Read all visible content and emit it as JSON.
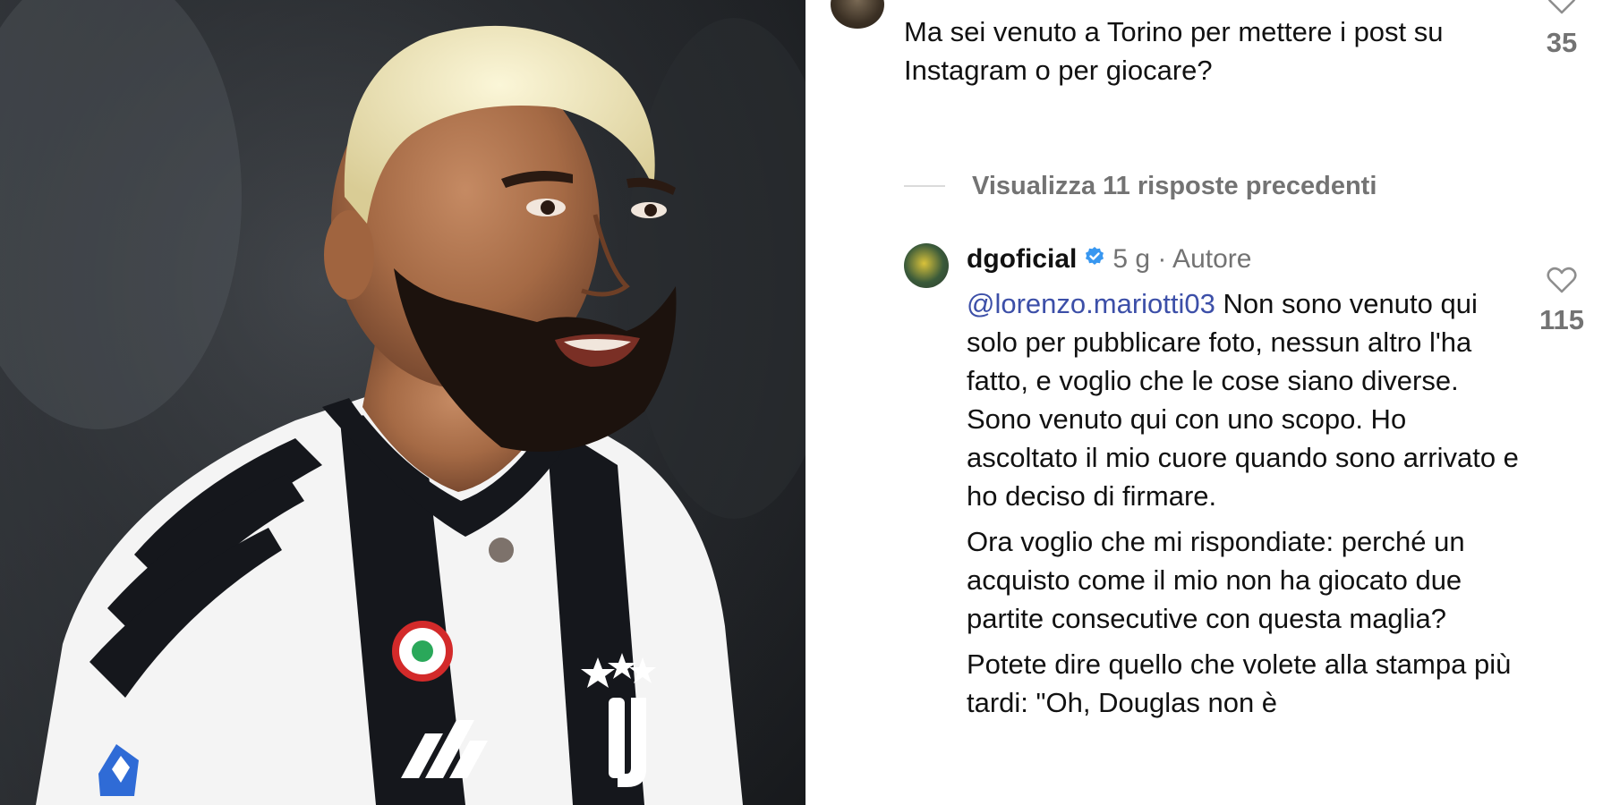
{
  "comments": {
    "top_comment": {
      "text": "Ma sei venuto a Torino per mettere i post su Instagram o per giocare?",
      "likes": "35",
      "avatar_icon": "profile-avatar"
    },
    "view_replies": {
      "label": "Visualizza 11 risposte precedenti"
    },
    "reply": {
      "username": "dgoficial",
      "verified_icon": "verified-badge-icon",
      "verified_color": "#3897f0",
      "meta": "5 g · Autore",
      "mention": "@lorenzo.mariotti03",
      "paragraph1_rest": " Non sono venuto qui solo per pubblicare foto, nessun altro l'ha fatto, e voglio che le cose siano diverse. Sono venuto qui con uno scopo. Ho ascoltato il mio cuore quando sono arrivato e ho deciso di firmare.",
      "paragraph2": "Ora voglio che mi rispondiate: perché un acquisto come il mio non ha giocato due partite consecutive con questa maglia?",
      "paragraph3": "Potete dire quello che volete alla stampa più tardi: \"Oh, Douglas non è",
      "likes": "115"
    }
  },
  "colors": {
    "mention": "#3c4fa8",
    "secondary_text": "#737373",
    "primary_text": "#111111",
    "jersey_black": "#15171c",
    "jersey_white": "#f4f4f4",
    "hair_blond": "#efe7c0"
  }
}
